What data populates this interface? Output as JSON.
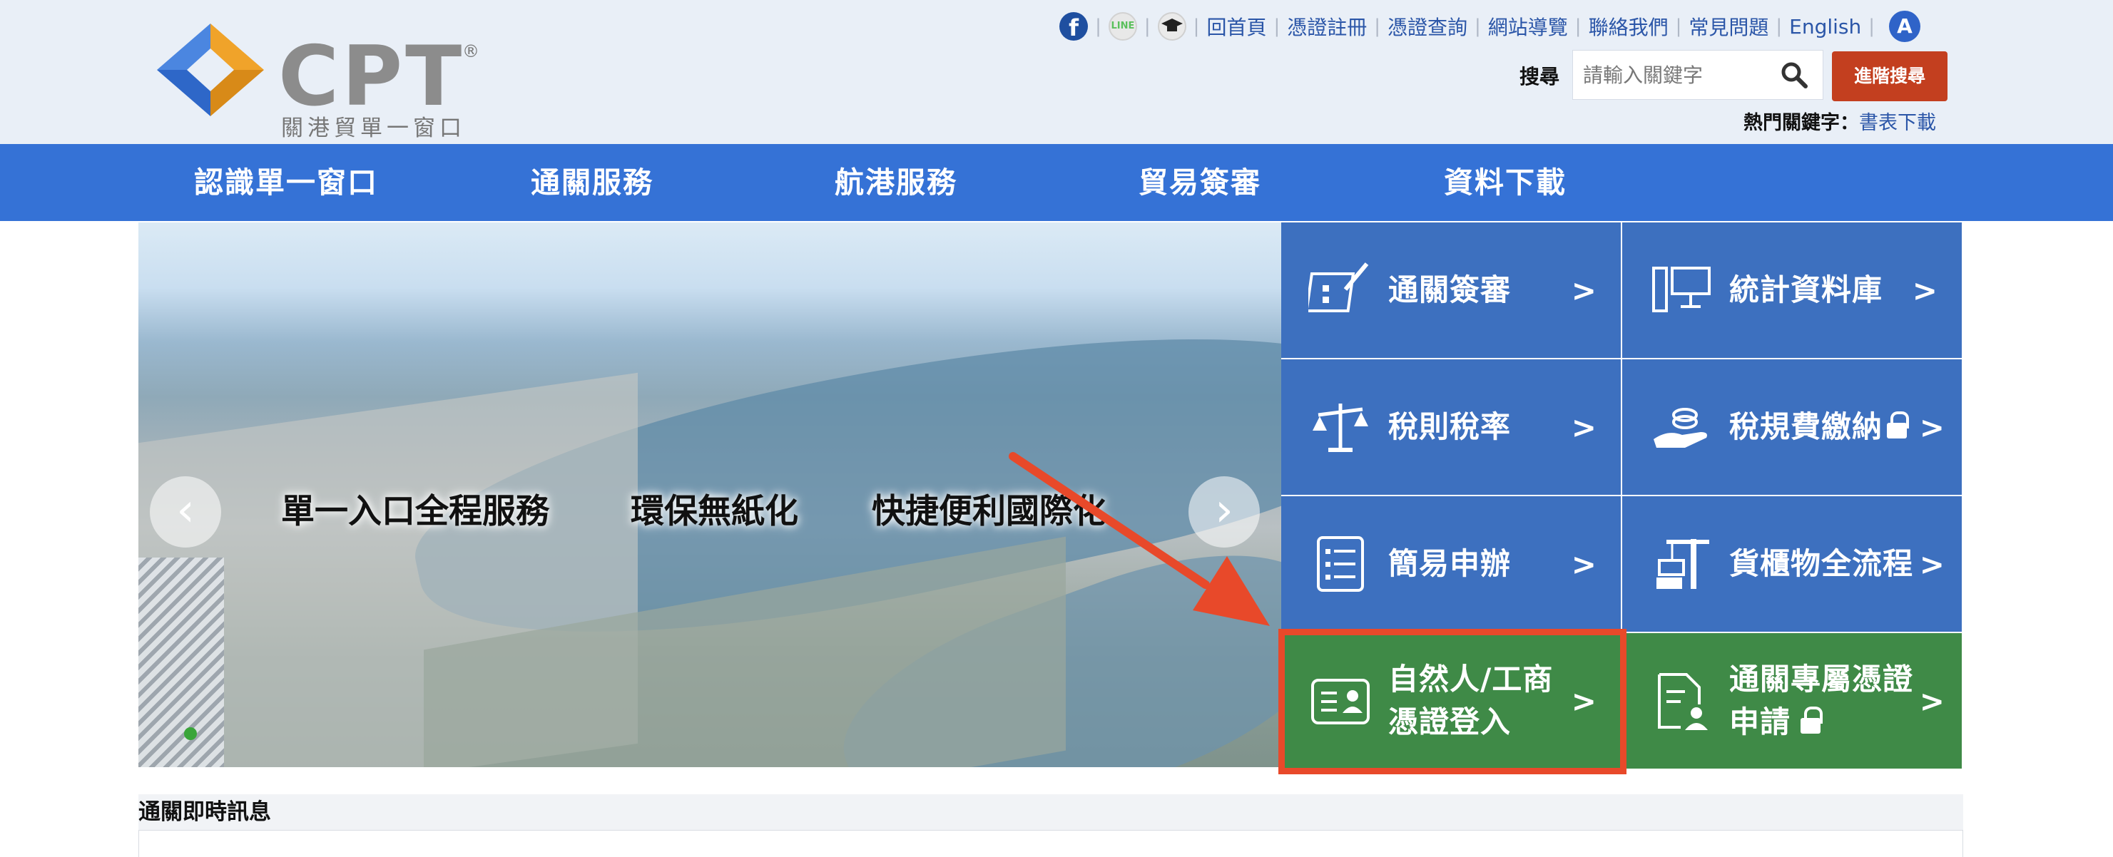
{
  "logo": {
    "text": "CPT",
    "registered": "®",
    "subtitle": "關港貿單一窗口"
  },
  "toplinks": {
    "icons": [
      "facebook-icon",
      "line-icon",
      "graduation-cap-icon"
    ],
    "line_text": "LINE",
    "fb_text": "f",
    "items": [
      "回首頁",
      "憑證註冊",
      "憑證查詢",
      "網站導覽",
      "聯絡我們",
      "常見問題",
      "English"
    ],
    "accessibility": "A"
  },
  "search": {
    "label": "搜尋",
    "placeholder": "請輸入關鍵字",
    "advanced_label": "進階搜尋",
    "hot_label": "熱門關鍵字：",
    "hot_value": "書表下載"
  },
  "nav": {
    "items": [
      "認識單一窗口",
      "通關服務",
      "航港服務",
      "貿易簽審",
      "資料下載"
    ]
  },
  "hero": {
    "slogans": [
      "單一入口全程服務",
      "環保無紙化",
      "快捷便利國際化"
    ],
    "prev": "‹",
    "next": "›"
  },
  "tiles": [
    {
      "label": "通關簽審",
      "chevron": ">",
      "icon": "form-pen-icon",
      "color": "#3d70bf"
    },
    {
      "label": "統計資料庫",
      "chevron": ">",
      "icon": "computer-icon",
      "color": "#3d70bf"
    },
    {
      "label": "稅則稅率",
      "chevron": ">",
      "icon": "scale-icon",
      "color": "#3d70bf"
    },
    {
      "label": "稅規費繳納",
      "chevron": ">",
      "icon": "hand-coins-icon",
      "color": "#3d70bf",
      "locked": true
    },
    {
      "label": "簡易申辦",
      "chevron": ">",
      "icon": "list-icon",
      "color": "#3d70bf"
    },
    {
      "label": "貨櫃物全流程",
      "chevron": ">",
      "icon": "crane-icon",
      "color": "#3d70bf"
    },
    {
      "label_line1": "自然人/工商",
      "label_line2": "憑證登入",
      "chevron": ">",
      "icon": "id-card-icon",
      "color": "#3f8a47"
    },
    {
      "label_line1": "通關專屬憑證",
      "label_line2": "申請",
      "chevron": ">",
      "icon": "certificate-icon",
      "color": "#3f8a47",
      "locked": true
    }
  ],
  "annotation": {
    "arrow_color": "#e8492a",
    "highlight_color": "#e8492a"
  },
  "news": {
    "title": "通關即時訊息"
  }
}
